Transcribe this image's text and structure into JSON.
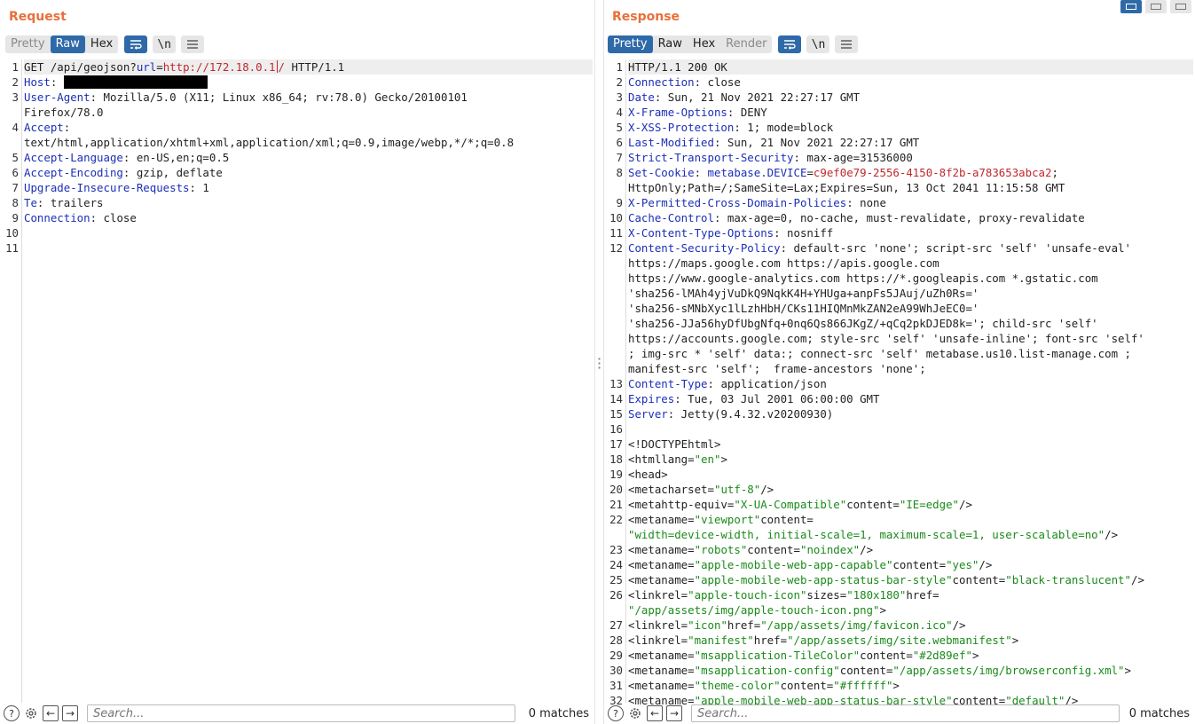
{
  "request": {
    "title": "Request",
    "tabs": [
      "Pretty",
      "Raw",
      "Hex"
    ],
    "active_tab": "Raw",
    "wrap_label": "\\n",
    "search_placeholder": "Search...",
    "matches": "0 matches",
    "lines": [
      {
        "n": "1",
        "html": "GET /api/geojson?<span class=\"hk\">url</span>=<span class=\"url\">http://172.18.0.1<span class=\"caret\"></span>/</span> HTTP/1.1"
      },
      {
        "n": "2",
        "html": "<span class=\"hk\">Host</span>: <span class=\"redact\"></span>"
      },
      {
        "n": "3",
        "html": "<span class=\"hk\">User-Agent</span>: Mozilla/5.0 (X11; Linux x86_64; rv:78.0) Gecko/20100101"
      },
      {
        "n": "",
        "html": "Firefox/78.0"
      },
      {
        "n": "4",
        "html": "<span class=\"hk\">Accept</span>:"
      },
      {
        "n": "",
        "html": "text/html,application/xhtml+xml,application/xml;q=0.9,image/webp,*/*;q=0.8"
      },
      {
        "n": "5",
        "html": "<span class=\"hk\">Accept-Language</span>: en-US,en;q=0.5"
      },
      {
        "n": "6",
        "html": "<span class=\"hk\">Accept-Encoding</span>: gzip, deflate"
      },
      {
        "n": "7",
        "html": "<span class=\"hk\">Upgrade-Insecure-Requests</span>: 1"
      },
      {
        "n": "8",
        "html": "<span class=\"hk\">Te</span>: trailers"
      },
      {
        "n": "9",
        "html": "<span class=\"hk\">Connection</span>: close"
      },
      {
        "n": "10",
        "html": ""
      },
      {
        "n": "11",
        "html": ""
      }
    ]
  },
  "response": {
    "title": "Response",
    "tabs": [
      "Pretty",
      "Raw",
      "Hex",
      "Render"
    ],
    "active_tab": "Pretty",
    "wrap_label": "\\n",
    "search_placeholder": "Search...",
    "matches": "0 matches",
    "lines": [
      {
        "n": "1",
        "html": "HTTP/1.1 200 OK"
      },
      {
        "n": "2",
        "html": "<span class=\"hk\">Connection</span>: close"
      },
      {
        "n": "3",
        "html": "<span class=\"hk\">Date</span>: Sun, 21 Nov 2021 22:27:17 GMT"
      },
      {
        "n": "4",
        "html": "<span class=\"hk\">X-Frame-Options</span>: DENY"
      },
      {
        "n": "5",
        "html": "<span class=\"hk\">X-XSS-Protection</span>: 1; mode=block"
      },
      {
        "n": "6",
        "html": "<span class=\"hk\">Last-Modified</span>: Sun, 21 Nov 2021 22:27:17 GMT"
      },
      {
        "n": "7",
        "html": "<span class=\"hk\">Strict-Transport-Security</span>: max-age=31536000"
      },
      {
        "n": "8",
        "html": "<span class=\"hk\">Set-Cookie</span>: <span class=\"hk\">metabase.DEVICE</span>=<span class=\"url\">c9ef0e79-2556-4150-8f2b-a783653abca2</span>;"
      },
      {
        "n": "",
        "html": "HttpOnly;Path=/;SameSite=Lax;Expires=Sun, 13 Oct 2041 11:15:58 GMT"
      },
      {
        "n": "9",
        "html": "<span class=\"hk\">X-Permitted-Cross-Domain-Policies</span>: none"
      },
      {
        "n": "10",
        "html": "<span class=\"hk\">Cache-Control</span>: max-age=0, no-cache, must-revalidate, proxy-revalidate"
      },
      {
        "n": "11",
        "html": "<span class=\"hk\">X-Content-Type-Options</span>: nosniff"
      },
      {
        "n": "12",
        "html": "<span class=\"hk\">Content-Security-Policy</span>: default-src 'none'; script-src 'self' 'unsafe-eval'"
      },
      {
        "n": "",
        "html": "https://maps.google.com https://apis.google.com"
      },
      {
        "n": "",
        "html": "https://www.google-analytics.com https://*.googleapis.com *.gstatic.com"
      },
      {
        "n": "",
        "html": "'sha256-lMAh4yjVuDkQ9NqkK4H+YHUga+anpFs5JAuj/uZh0Rs='"
      },
      {
        "n": "",
        "html": "'sha256-sMNbXyc1lLzhHbH/CKs11HIQMnMkZAN2eA99WhJeEC0='"
      },
      {
        "n": "",
        "html": "'sha256-JJa56hyDfUbgNfq+0nq6Qs866JKgZ/+qCq2pkDJED8k='; child-src 'self'"
      },
      {
        "n": "",
        "html": "https://accounts.google.com; style-src 'self' 'unsafe-inline'; font-src 'self'"
      },
      {
        "n": "",
        "html": "; img-src * 'self' data:; connect-src 'self' metabase.us10.list-manage.com ;"
      },
      {
        "n": "",
        "html": "manifest-src 'self';  frame-ancestors 'none';"
      },
      {
        "n": "13",
        "html": "<span class=\"hk\">Content-Type</span>: application/json"
      },
      {
        "n": "14",
        "html": "<span class=\"hk\">Expires</span>: Tue, 03 Jul 2001 06:00:00 GMT"
      },
      {
        "n": "15",
        "html": "<span class=\"hk\">Server</span>: Jetty(9.4.32.v20200930)"
      },
      {
        "n": "16",
        "html": ""
      },
      {
        "n": "17",
        "html": "&lt;!DOCTYPEhtml&gt;"
      },
      {
        "n": "18",
        "html": "&lt;htmllang=<span class=\"str\">\"en\"</span>&gt;"
      },
      {
        "n": "19",
        "html": "&lt;head&gt;"
      },
      {
        "n": "20",
        "html": "&lt;metacharset=<span class=\"str\">\"utf-8\"</span>/&gt;"
      },
      {
        "n": "21",
        "html": "&lt;metahttp-equiv=<span class=\"str\">\"X-UA-Compatible\"</span>content=<span class=\"str\">\"IE=edge\"</span>/&gt;"
      },
      {
        "n": "22",
        "html": "&lt;metaname=<span class=\"str\">\"viewport\"</span>content="
      },
      {
        "n": "",
        "html": "<span class=\"str\">\"width=device-width, initial-scale=1, maximum-scale=1, user-scalable=no\"</span>/&gt;"
      },
      {
        "n": "23",
        "html": "&lt;metaname=<span class=\"str\">\"robots\"</span>content=<span class=\"str\">\"noindex\"</span>/&gt;"
      },
      {
        "n": "24",
        "html": "&lt;metaname=<span class=\"str\">\"apple-mobile-web-app-capable\"</span>content=<span class=\"str\">\"yes\"</span>/&gt;"
      },
      {
        "n": "25",
        "html": "&lt;metaname=<span class=\"str\">\"apple-mobile-web-app-status-bar-style\"</span>content=<span class=\"str\">\"black-translucent\"</span>/&gt;"
      },
      {
        "n": "26",
        "html": "&lt;linkrel=<span class=\"str\">\"apple-touch-icon\"</span>sizes=<span class=\"str\">\"180x180\"</span>href="
      },
      {
        "n": "",
        "html": "<span class=\"str\">\"/app/assets/img/apple-touch-icon.png\"</span>&gt;"
      },
      {
        "n": "27",
        "html": "&lt;linkrel=<span class=\"str\">\"icon\"</span>href=<span class=\"str\">\"/app/assets/img/favicon.ico\"</span>/&gt;"
      },
      {
        "n": "28",
        "html": "&lt;linkrel=<span class=\"str\">\"manifest\"</span>href=<span class=\"str\">\"/app/assets/img/site.webmanifest\"</span>&gt;"
      },
      {
        "n": "29",
        "html": "&lt;metaname=<span class=\"str\">\"msapplication-TileColor\"</span>content=<span class=\"str\">\"#2d89ef\"</span>&gt;"
      },
      {
        "n": "30",
        "html": "&lt;metaname=<span class=\"str\">\"msapplication-config\"</span>content=<span class=\"str\">\"/app/assets/img/browserconfig.xml\"</span>&gt;"
      },
      {
        "n": "31",
        "html": "&lt;metaname=<span class=\"str\">\"theme-color\"</span>content=<span class=\"str\">\"#ffffff\"</span>&gt;"
      },
      {
        "n": "32",
        "html": "&lt;metaname=<span class=\"str\">\"apple-mobile-web-app-status-bar-style\"</span>content=<span class=\"str\">\"default\"</span>/&gt;"
      }
    ]
  },
  "icons": {
    "wrap": "word-wrap-icon",
    "menu": "hamburger-menu-icon",
    "help": "help-icon",
    "settings": "gear-icon",
    "back": "arrow-left-icon",
    "forward": "arrow-right-icon"
  },
  "colors": {
    "accent": "#e8703a",
    "active": "#2f6aa8",
    "header_key": "#1c2fb6",
    "url": "#c0282d",
    "string": "#1b8a1b"
  }
}
